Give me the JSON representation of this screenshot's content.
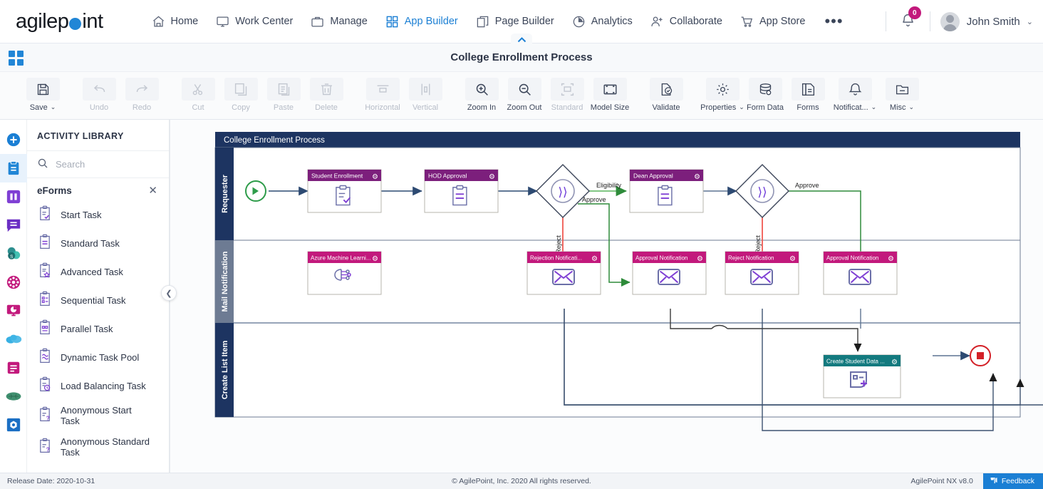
{
  "brand": {
    "name_part1": "agilep",
    "name_part2": "int",
    "accent": "#2186d6"
  },
  "topnav": {
    "items": [
      {
        "label": "Home",
        "icon": "home-icon",
        "active": false
      },
      {
        "label": "Work Center",
        "icon": "monitor-icon",
        "active": false
      },
      {
        "label": "Manage",
        "icon": "briefcase-icon",
        "active": false
      },
      {
        "label": "App Builder",
        "icon": "grid-icon",
        "active": true
      },
      {
        "label": "Page Builder",
        "icon": "pages-icon",
        "active": false
      },
      {
        "label": "Analytics",
        "icon": "pie-chart-icon",
        "active": false
      },
      {
        "label": "Collaborate",
        "icon": "user-add-icon",
        "active": false
      },
      {
        "label": "App Store",
        "icon": "cart-icon",
        "active": false
      }
    ],
    "overflow": "•••",
    "notification_count": "0",
    "username": "John Smith",
    "user_caret": "⌄"
  },
  "title_strip": {
    "title": "College Enrollment Process"
  },
  "toolbar": {
    "groups": [
      [
        {
          "label": "Save",
          "icon": "save-icon",
          "disabled": false,
          "dropdown": true
        }
      ],
      [
        {
          "label": "Undo",
          "icon": "undo-icon",
          "disabled": true,
          "dropdown": false
        },
        {
          "label": "Redo",
          "icon": "redo-icon",
          "disabled": true,
          "dropdown": false
        }
      ],
      [
        {
          "label": "Cut",
          "icon": "scissors-icon",
          "disabled": true,
          "dropdown": false
        },
        {
          "label": "Copy",
          "icon": "copy-icon",
          "disabled": true,
          "dropdown": false
        },
        {
          "label": "Paste",
          "icon": "paste-icon",
          "disabled": true,
          "dropdown": false
        },
        {
          "label": "Delete",
          "icon": "trash-icon",
          "disabled": true,
          "dropdown": false
        }
      ],
      [
        {
          "label": "Horizontal",
          "icon": "align-horizontal-icon",
          "disabled": true,
          "dropdown": false
        },
        {
          "label": "Vertical",
          "icon": "align-vertical-icon",
          "disabled": true,
          "dropdown": false
        }
      ],
      [
        {
          "label": "Zoom In",
          "icon": "zoom-in-icon",
          "disabled": false,
          "dropdown": false
        },
        {
          "label": "Zoom Out",
          "icon": "zoom-out-icon",
          "disabled": false,
          "dropdown": false
        },
        {
          "label": "Standard",
          "icon": "standard-size-icon",
          "disabled": true,
          "dropdown": false
        },
        {
          "label": "Model Size",
          "icon": "model-size-icon",
          "disabled": false,
          "dropdown": false
        }
      ],
      [
        {
          "label": "Validate",
          "icon": "validate-icon",
          "disabled": false,
          "dropdown": false
        }
      ],
      [
        {
          "label": "Properties",
          "icon": "gear-icon",
          "disabled": false,
          "dropdown": true
        },
        {
          "label": "Form Data",
          "icon": "database-icon",
          "disabled": false,
          "dropdown": false
        },
        {
          "label": "Forms",
          "icon": "document-copy-icon",
          "disabled": false,
          "dropdown": false
        },
        {
          "label": "Notificat...",
          "icon": "bell-icon",
          "disabled": false,
          "dropdown": true
        },
        {
          "label": "Misc",
          "icon": "folder-icon",
          "disabled": false,
          "dropdown": true
        }
      ]
    ]
  },
  "rail": {
    "items": [
      {
        "name": "add-icon",
        "color": "#1b7fd4",
        "selected": false
      },
      {
        "name": "clipboard-icon",
        "color": "#2186d6",
        "selected": true
      },
      {
        "name": "columns-icon",
        "color": "#7f3fd4",
        "selected": false
      },
      {
        "name": "message-icon",
        "color": "#6b2fc4",
        "selected": false
      },
      {
        "name": "sharepoint-icon",
        "color": "#178f8f",
        "selected": false
      },
      {
        "name": "network-icon",
        "color": "#c2197c",
        "selected": false
      },
      {
        "name": "dashboard-icon",
        "color": "#c2197c",
        "selected": false
      },
      {
        "name": "salesforce-icon",
        "color": "#38b0e3",
        "selected": false
      },
      {
        "name": "records-icon",
        "color": "#c2197c",
        "selected": false
      },
      {
        "name": "brain-icon",
        "color": "#3f8f6f",
        "selected": false
      },
      {
        "name": "azure-icon",
        "color": "#1b6fc4",
        "selected": false
      }
    ]
  },
  "sidebar": {
    "header": "ACTIVITY LIBRARY",
    "search_placeholder": "Search",
    "search_value": "",
    "group_name": "eForms",
    "group_close": "✕",
    "collapse_chevron": "❮",
    "items": [
      {
        "label": "Start Task",
        "icon": "start-task-icon"
      },
      {
        "label": "Standard Task",
        "icon": "standard-task-icon"
      },
      {
        "label": "Advanced Task",
        "icon": "advanced-task-icon"
      },
      {
        "label": "Sequential Task",
        "icon": "sequential-task-icon"
      },
      {
        "label": "Parallel Task",
        "icon": "parallel-task-icon"
      },
      {
        "label": "Dynamic Task Pool",
        "icon": "dynamic-task-pool-icon"
      },
      {
        "label": "Load Balancing Task",
        "icon": "load-balancing-task-icon"
      },
      {
        "label": "Anonymous Start Task",
        "icon": "anonymous-start-task-icon"
      },
      {
        "label": "Anonymous Standard Task",
        "icon": "anonymous-standard-task-icon"
      }
    ]
  },
  "diagram": {
    "pool_title": "College Enrollment Process",
    "pool_header_color": "#1d3461",
    "lanes": [
      {
        "label": "Requester"
      },
      {
        "label": "Mail Notification"
      },
      {
        "label": "Create List Item"
      }
    ],
    "nodes": [
      {
        "id": "start",
        "type": "start-event",
        "label": "",
        "color": "#2e9c4a"
      },
      {
        "id": "student-enrollment",
        "type": "task",
        "label": "Student Enrollment",
        "header_color": "#7c1f7c",
        "icon": "form-check-icon"
      },
      {
        "id": "hod-approval",
        "type": "task",
        "label": "HOD Approval",
        "header_color": "#7c1f7c",
        "icon": "form-lines-icon"
      },
      {
        "id": "gateway-1",
        "type": "gateway",
        "label": "",
        "color": "#3b4559"
      },
      {
        "id": "dean-approval",
        "type": "task",
        "label": "Dean Approval",
        "header_color": "#7c1f7c",
        "icon": "form-lines-icon"
      },
      {
        "id": "gateway-2",
        "type": "gateway",
        "label": "",
        "color": "#3b4559"
      },
      {
        "id": "azure-machine-learning",
        "type": "task",
        "label": "Azure Machine Learni...",
        "header_color": "#c2197c",
        "icon": "ml-brain-icon"
      },
      {
        "id": "rejection-notification",
        "type": "task",
        "label": "Rejection Notificati...",
        "header_color": "#c2197c",
        "icon": "envelope-icon"
      },
      {
        "id": "approval-notification-1",
        "type": "task",
        "label": "Approval Notification",
        "header_color": "#c2197c",
        "icon": "envelope-icon"
      },
      {
        "id": "reject-notification",
        "type": "task",
        "label": "Reject Notification",
        "header_color": "#c2197c",
        "icon": "envelope-icon"
      },
      {
        "id": "approval-notification-2",
        "type": "task",
        "label": "Approval Notification",
        "header_color": "#c2197c",
        "icon": "envelope-icon"
      },
      {
        "id": "create-student-data",
        "type": "task",
        "label": "Create Student Data ...",
        "header_color": "#137a7f",
        "icon": "list-add-icon"
      },
      {
        "id": "end",
        "type": "end-event",
        "label": "",
        "color": "#d32027"
      }
    ],
    "connector_labels": [
      {
        "text": "Eligibility",
        "color": "#3a9a42"
      },
      {
        "text": "Approve",
        "color": "#2e7d32"
      },
      {
        "text": "Reject",
        "color": "#d32027"
      },
      {
        "text": "Approve",
        "color": "#2e7d32"
      },
      {
        "text": "Reject",
        "color": "#d32027"
      }
    ],
    "gear_glyph": "⚙"
  },
  "status_bar": {
    "release": "Release Date: 2020-10-31",
    "copyright": "© AgilePoint, Inc. 2020 All rights reserved.",
    "version": "AgilePoint NX v8.0",
    "feedback": "Feedback"
  }
}
